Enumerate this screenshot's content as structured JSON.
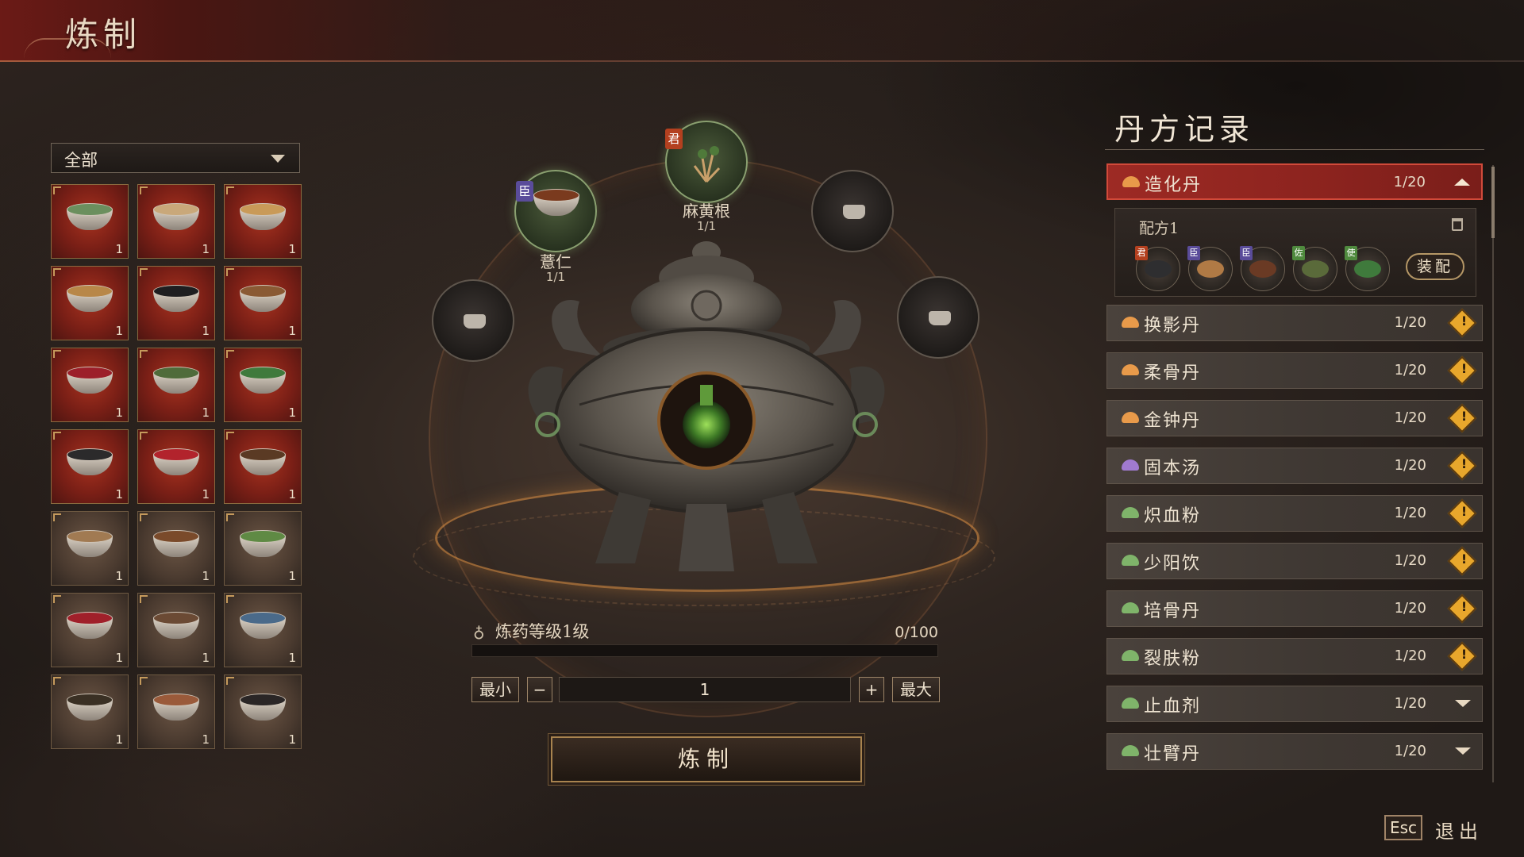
{
  "header": {
    "title": "炼制"
  },
  "filter": {
    "selected": "全部"
  },
  "inventory": [
    {
      "name": "herb-1",
      "count": "1",
      "bg": "red",
      "color": "#6b8f5e"
    },
    {
      "name": "herb-2",
      "count": "1",
      "bg": "red",
      "color": "#c9a87a"
    },
    {
      "name": "herb-3",
      "count": "1",
      "bg": "red",
      "color": "#c99a58"
    },
    {
      "name": "herb-4",
      "count": "1",
      "bg": "red",
      "color": "#b88748"
    },
    {
      "name": "herb-5",
      "count": "1",
      "bg": "red",
      "color": "#1e1e20"
    },
    {
      "name": "herb-6",
      "count": "1",
      "bg": "red",
      "color": "#8a5a34"
    },
    {
      "name": "herb-7",
      "count": "1",
      "bg": "red",
      "color": "#9c1f2a"
    },
    {
      "name": "herb-8",
      "count": "1",
      "bg": "red",
      "color": "#4f6b3a"
    },
    {
      "name": "herb-9",
      "count": "1",
      "bg": "red",
      "color": "#3f7a3c"
    },
    {
      "name": "herb-10",
      "count": "1",
      "bg": "red",
      "color": "#2b2a2b"
    },
    {
      "name": "herb-11",
      "count": "1",
      "bg": "red",
      "color": "#b2232c"
    },
    {
      "name": "herb-12",
      "count": "1",
      "bg": "red",
      "color": "#5a3a24"
    },
    {
      "name": "herb-13",
      "count": "1",
      "bg": "plain",
      "color": "#a17a52"
    },
    {
      "name": "herb-14",
      "count": "1",
      "bg": "plain",
      "color": "#7a4a2a"
    },
    {
      "name": "herb-15",
      "count": "1",
      "bg": "plain",
      "color": "#5f8a44"
    },
    {
      "name": "herb-16",
      "count": "1",
      "bg": "plain",
      "color": "#a0202a"
    },
    {
      "name": "herb-17",
      "count": "1",
      "bg": "plain",
      "color": "#6b4a34"
    },
    {
      "name": "herb-18",
      "count": "1",
      "bg": "plain",
      "color": "#4a6a8a"
    },
    {
      "name": "herb-19",
      "count": "1",
      "bg": "plain",
      "color": "#3a3024"
    },
    {
      "name": "herb-20",
      "count": "1",
      "bg": "plain",
      "color": "#9a5a3a"
    },
    {
      "name": "herb-21",
      "count": "1",
      "bg": "plain",
      "color": "#2a2626"
    }
  ],
  "slots": {
    "top": {
      "label": "麻黄根",
      "count": "1/1",
      "tag": "君"
    },
    "upper_left": {
      "label": "薏仁",
      "count": "1/1",
      "tag": "臣"
    }
  },
  "progress": {
    "label": "炼药等级1级",
    "value": "0/100",
    "fraction": 0.0
  },
  "quantity": {
    "min_label": "最小",
    "minus": "−",
    "value": "1",
    "plus": "+",
    "max_label": "最大"
  },
  "craft_button": "炼制",
  "recipes_panel": {
    "title": "丹方记录",
    "formula": {
      "name": "配方1",
      "equip_label": "装配",
      "ingredients": [
        {
          "tag": "君",
          "tag_color": "#b4401f",
          "color": "#2e2e30"
        },
        {
          "tag": "臣",
          "tag_color": "#5a4c9a",
          "color": "#b07a45"
        },
        {
          "tag": "臣",
          "tag_color": "#5a4c9a",
          "color": "#6a3a24"
        },
        {
          "tag": "佐",
          "tag_color": "#4f8a3e",
          "color": "#5a6a3a"
        },
        {
          "tag": "使",
          "tag_color": "#4f8a3e",
          "color": "#3f7a3c"
        }
      ]
    },
    "items": [
      {
        "name": "造化丹",
        "count": "1/20",
        "icon_color": "#e89a4a",
        "state": "active"
      },
      {
        "name": "换影丹",
        "count": "1/20",
        "icon_color": "#e89a4a",
        "state": "warn"
      },
      {
        "name": "柔骨丹",
        "count": "1/20",
        "icon_color": "#e89a4a",
        "state": "warn"
      },
      {
        "name": "金钟丹",
        "count": "1/20",
        "icon_color": "#e89a4a",
        "state": "warn"
      },
      {
        "name": "固本汤",
        "count": "1/20",
        "icon_color": "#a07ad0",
        "state": "warn"
      },
      {
        "name": "炽血粉",
        "count": "1/20",
        "icon_color": "#7fb46a",
        "state": "warn"
      },
      {
        "name": "少阳饮",
        "count": "1/20",
        "icon_color": "#7fb46a",
        "state": "warn"
      },
      {
        "name": "培骨丹",
        "count": "1/20",
        "icon_color": "#7fb46a",
        "state": "warn"
      },
      {
        "name": "裂肤粉",
        "count": "1/20",
        "icon_color": "#7fb46a",
        "state": "warn"
      },
      {
        "name": "止血剂",
        "count": "1/20",
        "icon_color": "#7fb46a",
        "state": "collapsed"
      },
      {
        "name": "壮臂丹",
        "count": "1/20",
        "icon_color": "#7fb46a",
        "state": "collapsed"
      }
    ]
  },
  "footer": {
    "esc_key": "Esc",
    "exit_label": "退出"
  }
}
